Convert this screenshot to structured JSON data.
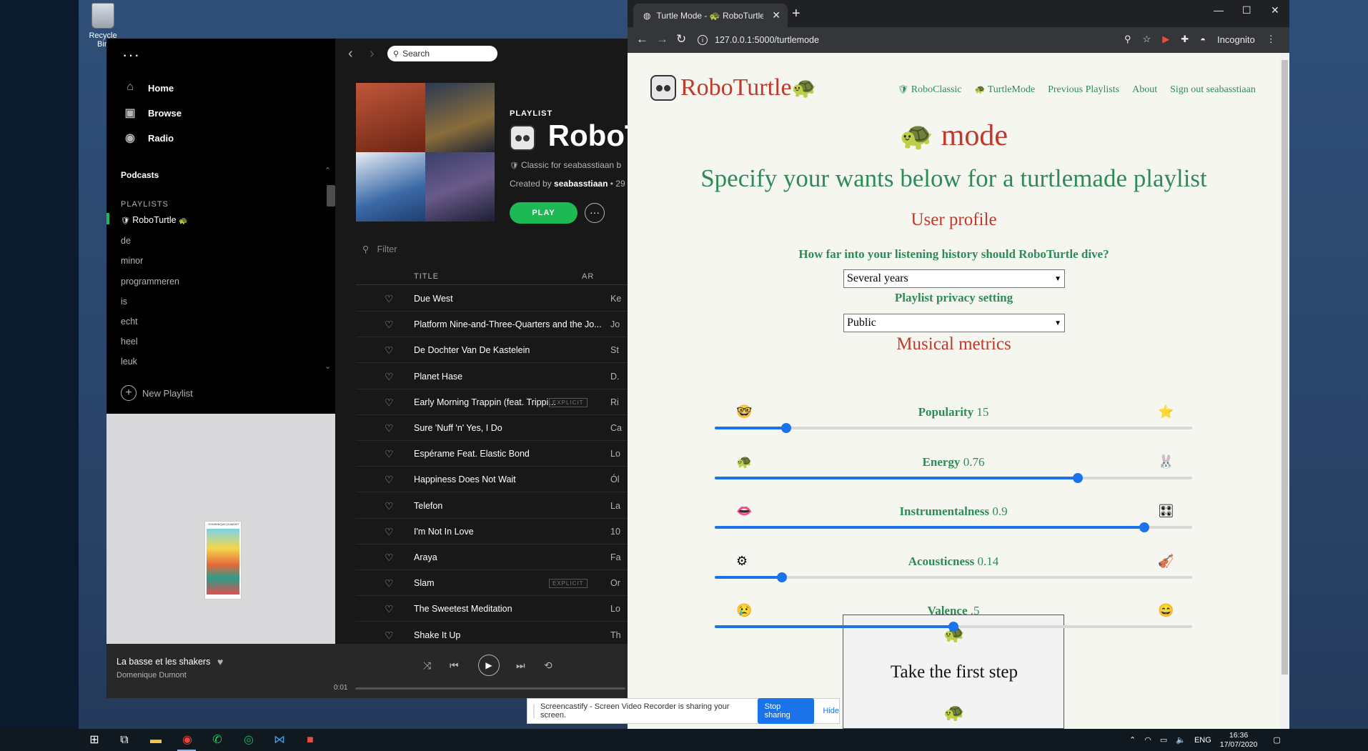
{
  "desktop": {
    "recycle_label": "Recycle Bin"
  },
  "spotify": {
    "nav": [
      {
        "label": "Home",
        "icon": "home-icon",
        "glyph": "⌂"
      },
      {
        "label": "Browse",
        "icon": "browse-icon",
        "glyph": "▣"
      },
      {
        "label": "Radio",
        "icon": "radio-icon",
        "glyph": "◉"
      }
    ],
    "podcasts_label": "Podcasts",
    "playlists_heading": "PLAYLISTS",
    "playlists": [
      "RoboTurtle",
      "de",
      "minor",
      "programmeren",
      "is",
      "echt",
      "heel",
      "leuk"
    ],
    "new_playlist_label": "New Playlist",
    "search_placeholder": "Search",
    "playlist_label": "PLAYLIST",
    "playlist_title": "RoboT",
    "playlist_desc": "Classic for seabasstiaan b",
    "created_by_prefix": "Created by",
    "created_by_user": "seabasstiaan",
    "created_by_suffix": " • 29",
    "play_label": "PLAY",
    "more_label": "···",
    "filter_placeholder": "Filter",
    "col_title": "TITLE",
    "col_artist": "AR",
    "explicit_label": "EXPLICIT",
    "tracks": [
      {
        "title": "Due West",
        "artist": "Ke",
        "explicit": false
      },
      {
        "title": "Platform Nine-and-Three-Quarters and the Jo...",
        "artist": "Jo",
        "explicit": false
      },
      {
        "title": "De Dochter Van De Kastelein",
        "artist": "St",
        "explicit": false
      },
      {
        "title": "Planet Hase",
        "artist": "D.",
        "explicit": false
      },
      {
        "title": "Early Morning Trappin (feat. Trippi...",
        "artist": "Ri",
        "explicit": true
      },
      {
        "title": "Sure 'Nuff 'n' Yes, I Do",
        "artist": "Ca",
        "explicit": false
      },
      {
        "title": "Espérame Feat. Elastic Bond",
        "artist": "Lo",
        "explicit": false
      },
      {
        "title": "Happiness Does Not Wait",
        "artist": "Ól",
        "explicit": false
      },
      {
        "title": "Telefon",
        "artist": "La",
        "explicit": false
      },
      {
        "title": "I'm Not In Love",
        "artist": "10",
        "explicit": false
      },
      {
        "title": "Araya",
        "artist": "Fa",
        "explicit": false
      },
      {
        "title": "Slam",
        "artist": "Or",
        "explicit": true
      },
      {
        "title": "The Sweetest Meditation",
        "artist": "Lo",
        "explicit": false
      },
      {
        "title": "Shake It Up",
        "artist": "Th",
        "explicit": false
      }
    ],
    "now_playing": {
      "title": "La basse et les shakers",
      "artist": "Domenique Dumont",
      "elapsed": "0:01"
    },
    "album_card_artist": "DOMENIQUE DUMONT"
  },
  "chrome": {
    "tab_title": "Turtle Mode - 🐢 RoboTurtle",
    "url": "127.0.0.1:5000/turtlemode",
    "incognito_label": "Incognito"
  },
  "page": {
    "logo_text": "RoboTurtle",
    "nav": [
      "RoboClassic",
      "TurtleMode",
      "Previous Playlists",
      "About",
      "Sign out seabasstiaan"
    ],
    "mode_word": "mode",
    "specify": "Specify your wants below for a turtlemade playlist",
    "user_profile": "User profile",
    "history_question": "How far into your listening history should RoboTurtle dive?",
    "history_value": "Several years",
    "privacy_label": "Playlist privacy setting",
    "privacy_value": "Public",
    "metrics_heading": "Musical metrics",
    "metrics": [
      {
        "name": "Popularity",
        "value_text": "15",
        "level": 0.15,
        "left_icon": "nerd-face-icon",
        "left_glyph": "🤓",
        "right_icon": "star-icon",
        "right_glyph": "⭐"
      },
      {
        "name": "Energy",
        "value_text": "0.76",
        "level": 0.76,
        "left_icon": "turtle-icon",
        "left_glyph": "🐢",
        "right_icon": "rabbit-icon",
        "right_glyph": "🐰"
      },
      {
        "name": "Instrumentalness",
        "value_text": "0.9",
        "level": 0.9,
        "left_icon": "lips-icon",
        "left_glyph": "👄",
        "right_icon": "control-knobs-icon",
        "right_glyph": "🎛"
      },
      {
        "name": "Acousticness",
        "value_text": "0.14",
        "level": 0.14,
        "left_icon": "gear-icon",
        "left_glyph": "⚙",
        "right_icon": "violin-icon",
        "right_glyph": "🎻"
      },
      {
        "name": "Valence",
        "value_text": ".5",
        "level": 0.5,
        "left_icon": "crying-face-icon",
        "left_glyph": "😢",
        "right_icon": "grinning-face-icon",
        "right_glyph": "😄"
      }
    ],
    "cta": "Take the first step"
  },
  "notice": {
    "text": "Screencastify - Screen Video Recorder is sharing your screen.",
    "stop": "Stop sharing",
    "hide": "Hide"
  },
  "taskbar": {
    "lang": "ENG",
    "time": "16:36",
    "date": "17/07/2020"
  },
  "colors": {
    "spotify_green": "#1db954",
    "page_green": "#2e8b57",
    "page_red": "#c0392b",
    "slider_blue": "#1a73e8"
  }
}
